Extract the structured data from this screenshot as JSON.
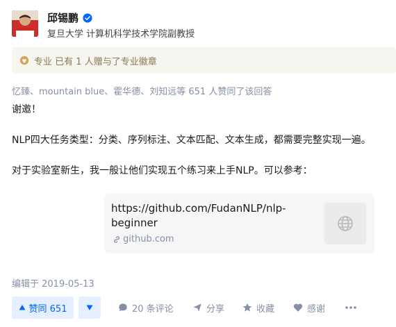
{
  "author": {
    "name": "邱锡鹏",
    "headline": "复旦大学 计算机科学技术学院副教授"
  },
  "badge": {
    "label": "专业",
    "text": "已有 1 人赠与了专业徽章"
  },
  "voters_text": "忆臻、mountain blue、霍华德、刘知远等 651 人赞同了该回答",
  "content": {
    "p1": "谢邀！",
    "p2": "NLP四大任务类型：分类、序列标注、文本匹配、文本生成，都需要完整实现一遍。",
    "p3": "对于实验室新生，我一般让他们实现五个练习来上手NLP。可以参考："
  },
  "link_card": {
    "title": "https://github.com/FudanNLP/nlp-beginner",
    "host": "github.com"
  },
  "edited": "编辑于 2019-05-13",
  "actions": {
    "upvote": "赞同 651",
    "comments": "20 条评论",
    "share": "分享",
    "collect": "收藏",
    "thanks": "感谢"
  },
  "colors": {
    "accent": "#0066ff",
    "badge_bg": "#f7f5ef",
    "meta": "#8590a6"
  }
}
